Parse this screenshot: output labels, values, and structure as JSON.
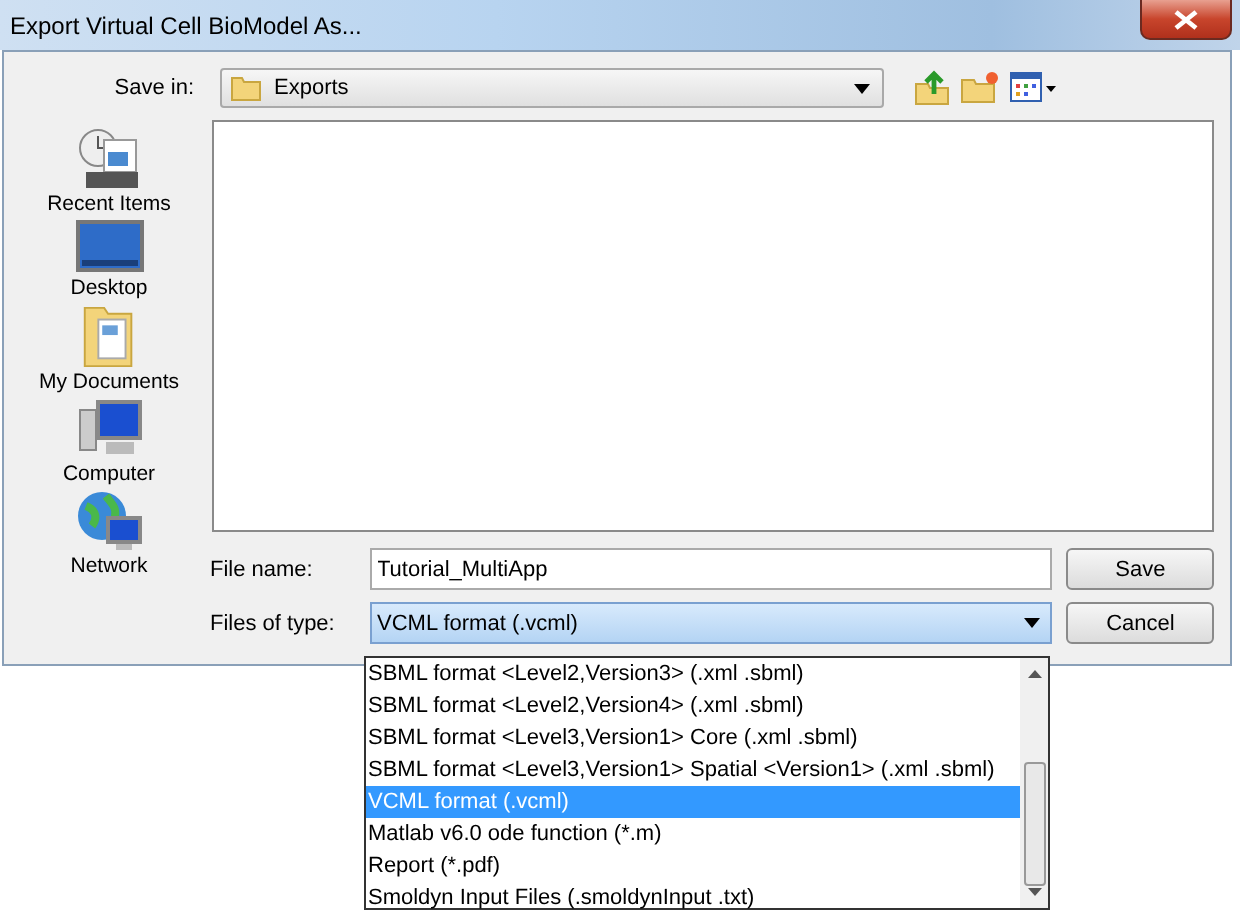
{
  "window": {
    "title": "Export Virtual Cell BioModel As..."
  },
  "save_in": {
    "label": "Save in:",
    "value": "Exports"
  },
  "sidebar": {
    "items": [
      {
        "label": "Recent Items",
        "kind": "recent"
      },
      {
        "label": "Desktop",
        "kind": "desktop"
      },
      {
        "label": "My Documents",
        "kind": "documents"
      },
      {
        "label": "Computer",
        "kind": "computer"
      },
      {
        "label": "Network",
        "kind": "network"
      }
    ]
  },
  "file_name": {
    "label": "File name:",
    "value": "Tutorial_MultiApp"
  },
  "files_of_type": {
    "label": "Files of type:",
    "value": "VCML format (.vcml)",
    "expanded": true,
    "options": [
      {
        "label": "SBML format <Level2,Version3>  (.xml .sbml)",
        "selected": false
      },
      {
        "label": "SBML format <Level2,Version4>  (.xml .sbml)",
        "selected": false
      },
      {
        "label": "SBML format <Level3,Version1> Core (.xml .sbml)",
        "selected": false
      },
      {
        "label": "SBML format <Level3,Version1> Spatial <Version1> (.xml .sbml)",
        "selected": false
      },
      {
        "label": "VCML format (.vcml)",
        "selected": true
      },
      {
        "label": "Matlab v6.0 ode function (*.m)",
        "selected": false
      },
      {
        "label": "Report (*.pdf)",
        "selected": false
      },
      {
        "label": "Smoldyn Input Files (.smoldynInput .txt)",
        "selected": false
      }
    ]
  },
  "buttons": [
    {
      "label": "Save"
    },
    {
      "label": "Cancel"
    }
  ]
}
